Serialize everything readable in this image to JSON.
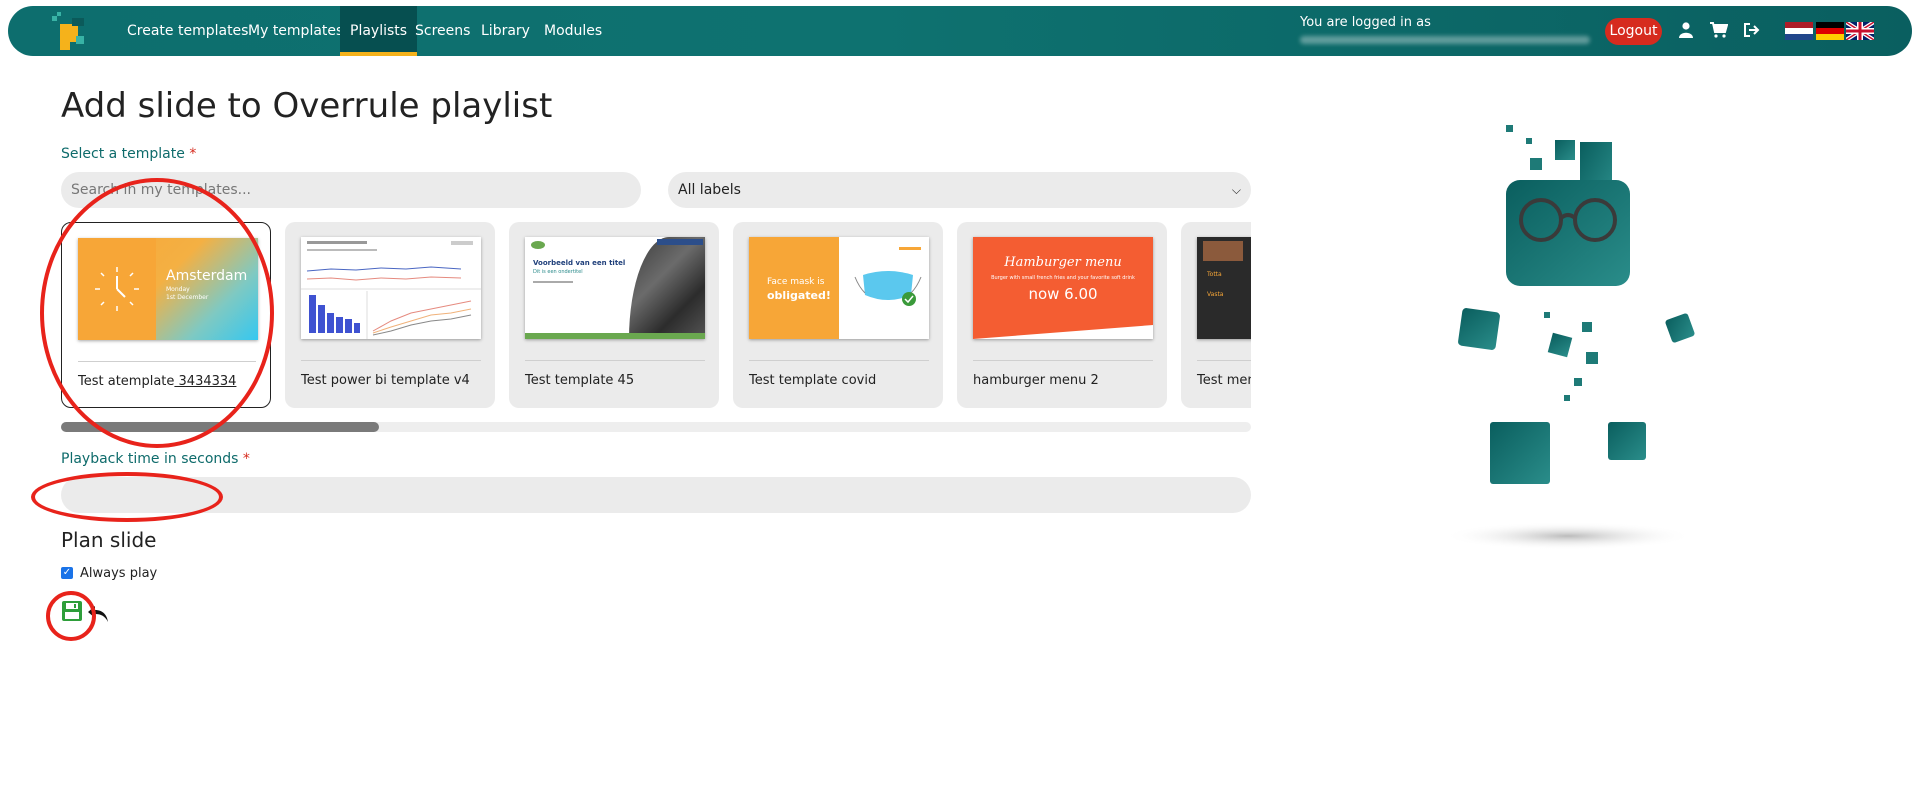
{
  "nav": {
    "items": [
      {
        "label": "Create templates"
      },
      {
        "label": "My templates"
      },
      {
        "label": "Playlists"
      },
      {
        "label": "Screens"
      },
      {
        "label": "Library"
      },
      {
        "label": "Modules"
      }
    ],
    "active": "Playlists",
    "logged_in_as": "You are logged in as",
    "logout_label": "Logout",
    "icons": [
      "user-icon",
      "cart-icon",
      "sign-out-icon"
    ],
    "flags": [
      "flag-nl",
      "flag-de",
      "flag-uk"
    ]
  },
  "page": {
    "title": "Add slide to Overrule playlist",
    "select_template_label": "Select a template",
    "required_mark": "*",
    "search_placeholder": "Search in my templates...",
    "labels_select": "All labels",
    "playback_label": "Playback time in seconds",
    "plan_title": "Plan slide",
    "always_play_label": "Always play",
    "always_play_checked": true
  },
  "templates": [
    {
      "name": "Test atemplate",
      "name_suffix": " 3434334",
      "thumb": {
        "city": "Amsterdam",
        "sub": "Monday",
        "date": "1st December"
      }
    },
    {
      "name": "Test power bi template v4"
    },
    {
      "name": "Test template 45",
      "thumb": {
        "headline": "Voorbeeld van een titel",
        "subline": "Dit is een ondertitel"
      }
    },
    {
      "name": "Test template covid",
      "thumb": {
        "line1": "Face mask is",
        "line2": "obligated!"
      }
    },
    {
      "name": "hamburger menu 2",
      "thumb": {
        "heading": "Hamburger menu",
        "desc": "Burger with small french fries and your favorite soft drink",
        "price": "now 6.00"
      }
    },
    {
      "name": "Test menu",
      "thumb": {
        "l1": "Totta",
        "l2": "Vasta"
      }
    }
  ],
  "colors": {
    "brand": "#0e7270",
    "accent": "#f5b21b",
    "danger": "#d62b1e",
    "save": "#2e9e3a"
  }
}
